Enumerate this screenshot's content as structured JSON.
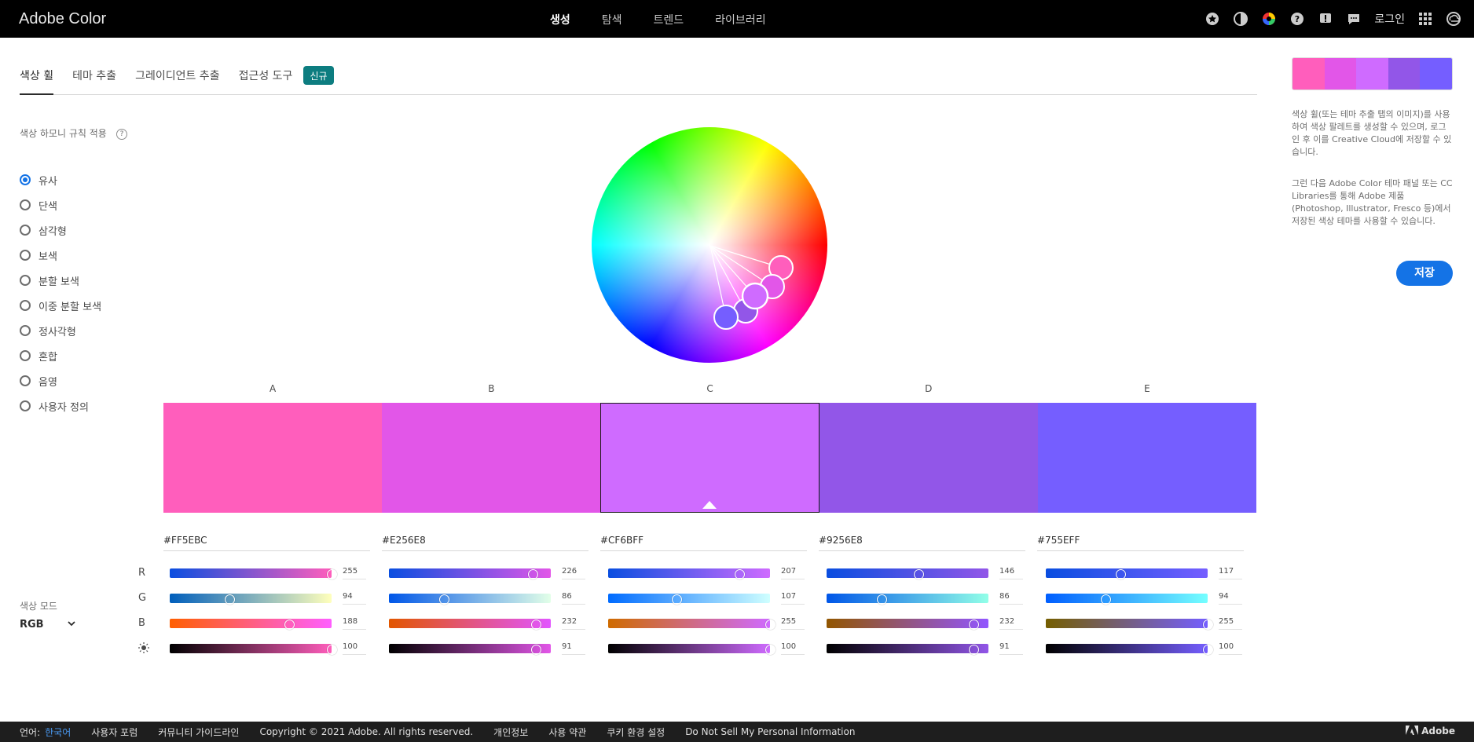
{
  "app": {
    "title": "Adobe Color"
  },
  "nav": [
    "생성",
    "탐색",
    "트렌드",
    "라이브러리"
  ],
  "top": {
    "login": "로그인"
  },
  "tabs": {
    "items": [
      "색상 휠",
      "테마 추출",
      "그레이디언트 추출",
      "접근성 도구"
    ],
    "new_badge": "신규"
  },
  "harmony": {
    "title": "색상 하모니 규칙 적용",
    "help": "?",
    "rules": [
      "유사",
      "단색",
      "삼각형",
      "보색",
      "분할 보색",
      "이중 분할 보색",
      "정사각형",
      "혼합",
      "음영",
      "사용자 정의"
    ],
    "selected": "유사"
  },
  "color_mode": {
    "label": "색상 모드",
    "value": "RGB"
  },
  "swatches": [
    {
      "label": "A",
      "hex": "#FF5EBC",
      "color": "#FF5EBC",
      "values": [
        "255",
        "94",
        "188",
        "100"
      ],
      "levels": [
        1.0,
        0.37,
        0.74,
        1.0
      ]
    },
    {
      "label": "B",
      "hex": "#E256E8",
      "color": "#E256E8",
      "values": [
        "226",
        "86",
        "232",
        "91"
      ],
      "levels": [
        0.89,
        0.34,
        0.91,
        0.91
      ]
    },
    {
      "label": "C",
      "hex": "#CF6BFF",
      "color": "#CF6BFF",
      "values": [
        "207",
        "107",
        "255",
        "100"
      ],
      "levels": [
        0.81,
        0.42,
        1.0,
        1.0
      ]
    },
    {
      "label": "D",
      "hex": "#9256E8",
      "color": "#9256E8",
      "values": [
        "146",
        "86",
        "232",
        "91"
      ],
      "levels": [
        0.57,
        0.34,
        0.91,
        0.91
      ]
    },
    {
      "label": "E",
      "hex": "#755EFF",
      "color": "#755EFF",
      "values": [
        "117",
        "94",
        "255",
        "100"
      ],
      "levels": [
        0.46,
        0.37,
        1.0,
        1.0
      ]
    }
  ],
  "selected_swatch": "C",
  "channels": [
    "R",
    "G",
    "B"
  ],
  "right": {
    "desc1": "색상 휠(또는 테마 추출 탭의 이미지)를 사용하여 색상 팔레트를 생성할 수 있으며, 로그인 후 이를 Creative Cloud에 저장할 수 있습니다.",
    "desc2": "그런 다음 Adobe Color 테마 패널 또는 CC Libraries를 통해 Adobe 제품(Photoshop, Illustrator, Fresco 등)에서 저장된 색상 테마를 사용할 수 있습니다.",
    "save": "저장"
  },
  "footer": {
    "lang_label": "언어:",
    "lang": "한국어",
    "links": [
      "사용자 포럼",
      "커뮤니티 가이드라인",
      "Copyright © 2021 Adobe. All rights reserved.",
      "개인정보",
      "사용 약관",
      "쿠키 환경 설정",
      "Do Not Sell My Personal Information"
    ],
    "brand": "Adobe"
  },
  "colors": {
    "accent": "#1473e6",
    "badge": "#0d7d80"
  }
}
